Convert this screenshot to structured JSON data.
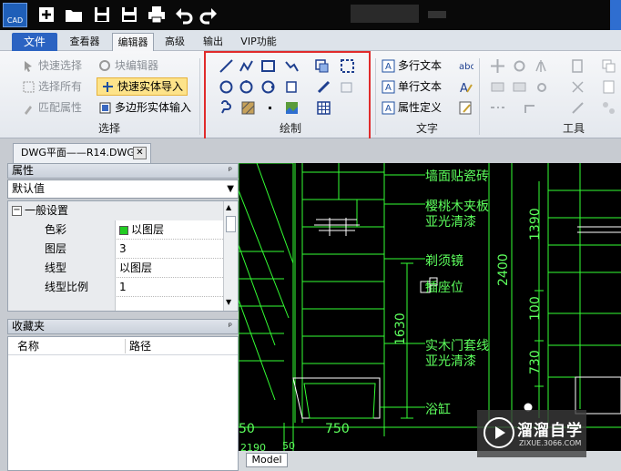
{
  "titlebar": {
    "app_icon_label": "CAD"
  },
  "menu": {
    "tabs": [
      "文件",
      "查看器",
      "编辑器",
      "高级",
      "输出",
      "VIP功能"
    ],
    "active": "编辑器"
  },
  "ribbon": {
    "select": {
      "items": [
        "快速选择",
        "选择所有",
        "匹配属性"
      ],
      "label": "选择"
    },
    "block": {
      "items": [
        "块编辑器",
        "快速实体导入",
        "多边形实体输入"
      ]
    },
    "draw": {
      "label": "绘制"
    },
    "text": {
      "items": [
        "多行文本",
        "单行文本",
        "属性定义"
      ],
      "label": "文字"
    },
    "tools": {
      "label": "工具"
    }
  },
  "doc_tab": {
    "title": "DWG平面——R14.DWG",
    "close": "✕"
  },
  "properties": {
    "header": "属性",
    "pin": "ᵖ",
    "selector": "默认值",
    "group": "一般设置",
    "rows": [
      {
        "key": "色彩",
        "value": "以图层",
        "swatch": "#22cc22"
      },
      {
        "key": "图层",
        "value": "3"
      },
      {
        "key": "线型",
        "value": "以图层"
      },
      {
        "key": "线型比例",
        "value": "1"
      }
    ]
  },
  "favorites": {
    "header": "收藏夹",
    "columns": [
      "名称",
      "路径"
    ]
  },
  "cad": {
    "labels": [
      "墙面贴瓷砖",
      "樱桃木夹板",
      "亚光清漆",
      "剃须镜",
      "插座位",
      "实木门套线",
      "亚光清漆",
      "浴缸"
    ],
    "dims_h": [
      "750",
      "50",
      "50",
      "2190"
    ],
    "dims_v": [
      "1630",
      "2400",
      "1390",
      "100",
      "730"
    ],
    "line_color": "#33ff33"
  },
  "model_tab": "Model",
  "watermark": {
    "title": "溜溜自学",
    "url": "ZIXUE.3066.COM"
  }
}
